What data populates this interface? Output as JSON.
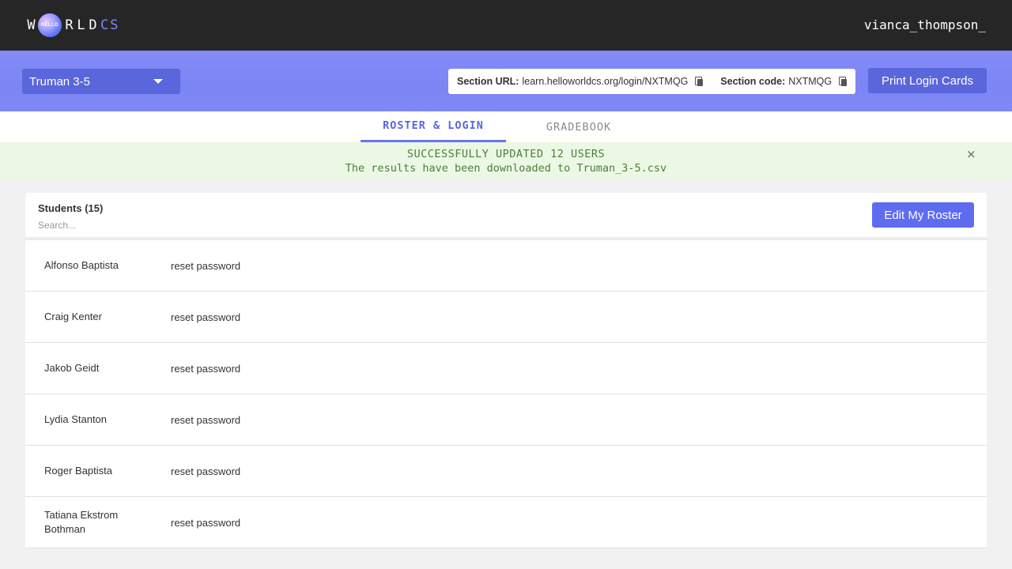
{
  "header": {
    "logo": {
      "letters": [
        "W",
        "R",
        "L",
        "D"
      ],
      "globe_text": "HELLO",
      "suffix": "CS"
    },
    "username": "vianca_thompson_"
  },
  "section_bar": {
    "selected_section": "Truman 3-5",
    "url_label": "Section URL:",
    "url_value": "learn.helloworldcs.org/login/NXTMQG",
    "code_label": "Section code:",
    "code_value": "NXTMQG",
    "print_button": "Print Login Cards"
  },
  "tabs": [
    {
      "label": "ROSTER & LOGIN",
      "active": true
    },
    {
      "label": "GRADEBOOK",
      "active": false
    }
  ],
  "banner": {
    "title": "SUCCESSFULLY UPDATED 12 USERS",
    "message": "The results have been downloaded to Truman_3-5.csv",
    "close": "×"
  },
  "roster": {
    "title": "Students (15)",
    "search_placeholder": "Search...",
    "edit_button": "Edit My Roster",
    "students": [
      {
        "name": "Alfonso Baptista",
        "action": "reset password"
      },
      {
        "name": "Craig Kenter",
        "action": "reset password"
      },
      {
        "name": "Jakob Geidt",
        "action": "reset password"
      },
      {
        "name": "Lydia Stanton",
        "action": "reset password"
      },
      {
        "name": "Roger Baptista",
        "action": "reset password"
      },
      {
        "name": "Tatiana Ekstrom Bothman",
        "action": "reset password"
      }
    ]
  },
  "colors": {
    "topbar": "#262626",
    "accent": "#5e6cf0",
    "section_bar": "#7f88f5",
    "success_bg": "#ebf8e4",
    "success_text": "#4f7d3c"
  },
  "icons": {
    "dropdown": "chevron-down-icon",
    "copy": "copy-icon",
    "close": "close-icon"
  }
}
